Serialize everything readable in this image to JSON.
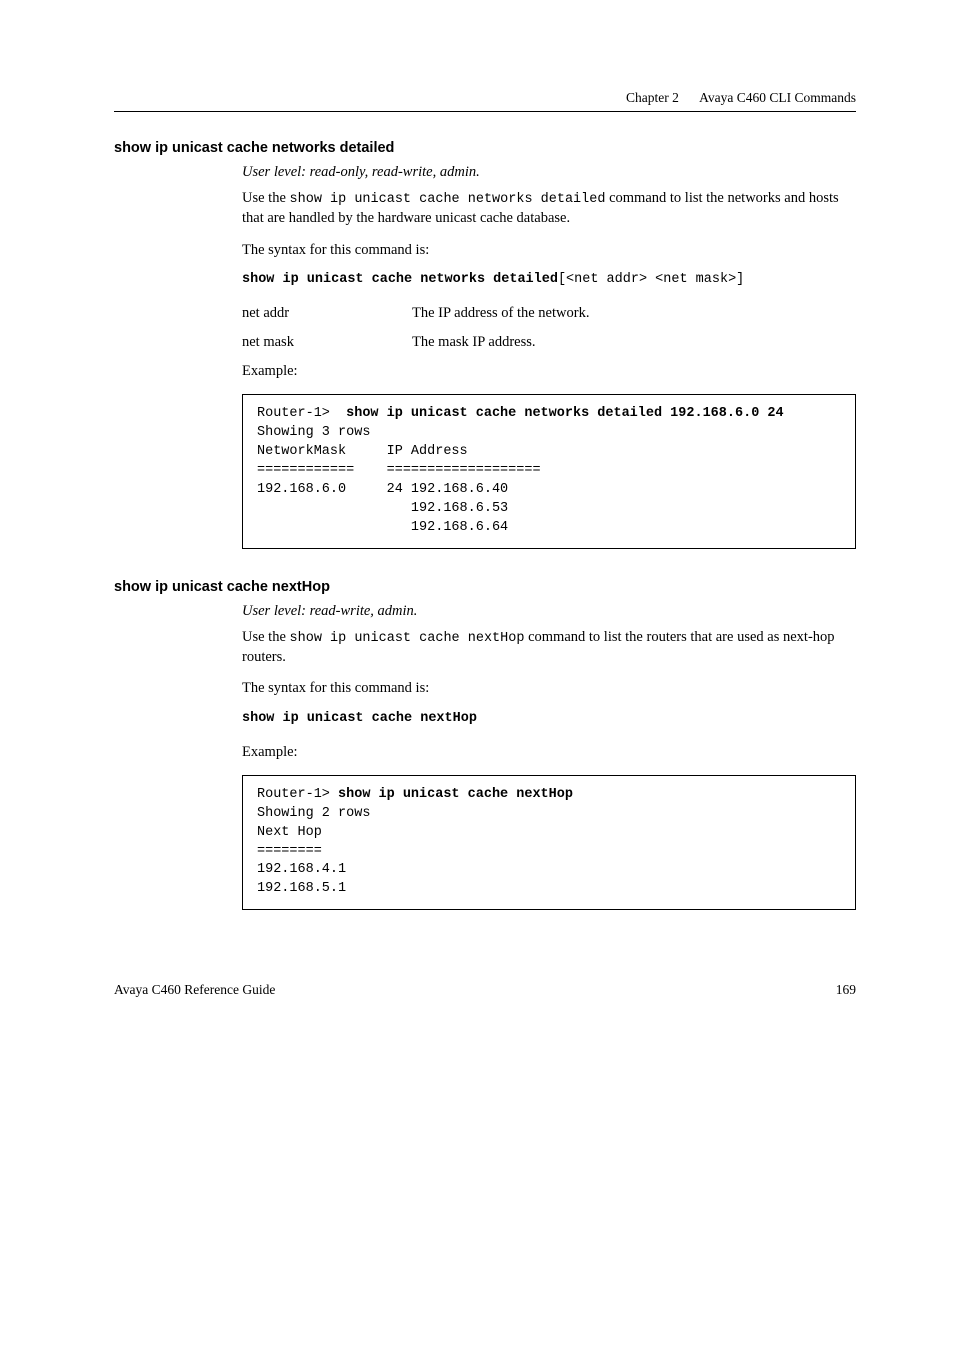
{
  "header": {
    "chapter": "Chapter 2",
    "title": "Avaya C460 CLI Commands"
  },
  "section1": {
    "heading": "show ip unicast cache networks detailed",
    "userlevel": "User level: read-only, read-write, admin.",
    "body_prefix": "Use the ",
    "body_cmd": "show ip unicast cache networks detailed",
    "body_suffix": " command to list the networks and hosts that are handled by the hardware unicast cache database.",
    "syntax_label": "The syntax for this command is:",
    "syntax_bold": "show ip unicast cache networks detailed",
    "syntax_args": "[<net addr> <net mask>]",
    "params": [
      {
        "name": "net addr",
        "desc": "The IP address of the network."
      },
      {
        "name": "net mask",
        "desc": "The mask IP address."
      }
    ],
    "example_label": "Example:",
    "code_prompt": "Router-1>  ",
    "code_cmd_bold": "show ip unicast cache networks detailed 192.168.6.0 24",
    "code_rest": "Showing 3 rows\nNetworkMask     IP Address\n============    ===================\n192.168.6.0     24 192.168.6.40\n                   192.168.6.53\n                   192.168.6.64"
  },
  "section2": {
    "heading": "show ip unicast cache nextHop",
    "userlevel": "User level: read-write, admin.",
    "body_prefix": "Use the ",
    "body_cmd": "show ip unicast cache nextHop",
    "body_suffix": " command to list the routers that are used as next-hop routers.",
    "syntax_label": "The syntax for this command is:",
    "syntax_bold": "show ip unicast cache nextHop",
    "example_label": "Example:",
    "code_prompt": "Router-1> ",
    "code_cmd_bold": "show ip unicast cache nextHop",
    "code_rest": "Showing 2 rows\nNext Hop\n========\n192.168.4.1\n192.168.5.1"
  },
  "footer": {
    "left": "Avaya C460 Reference Guide",
    "right": "169"
  }
}
